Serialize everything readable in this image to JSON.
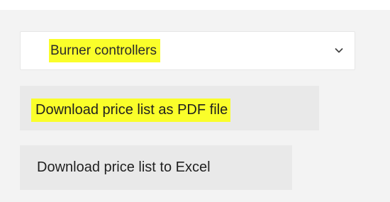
{
  "category_select": {
    "selected": "Burner controllers",
    "highlight_color": "#fafe2a"
  },
  "buttons": {
    "pdf_label": "Download price list as PDF file",
    "excel_label": "Download price list to Excel"
  },
  "icons": {
    "dropdown": "chevron-down-icon"
  },
  "colors": {
    "panel_bg": "#f3f3f3",
    "button_bg": "#e9e9e9",
    "highlight": "#fafe2a"
  }
}
